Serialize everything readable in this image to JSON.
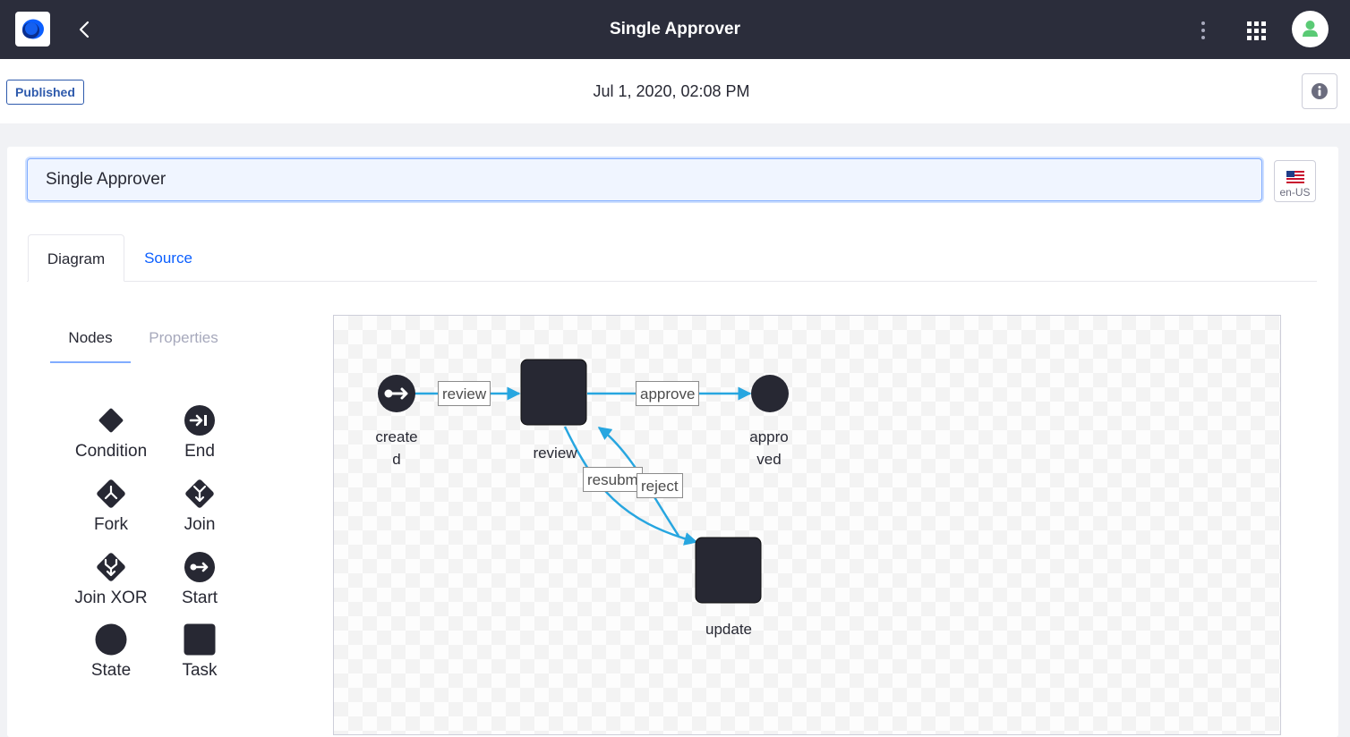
{
  "header": {
    "title": "Single Approver"
  },
  "subheader": {
    "status_badge": "Published",
    "date": "Jul 1, 2020, 02:08 PM"
  },
  "form": {
    "name_value": "Single Approver",
    "language_label": "en-US"
  },
  "tabs": {
    "diagram": "Diagram",
    "source": "Source"
  },
  "panel": {
    "nodes_tab": "Nodes",
    "properties_tab": "Properties",
    "nodes": [
      {
        "label": "Condition",
        "icon": "condition-icon"
      },
      {
        "label": "End",
        "icon": "end-icon"
      },
      {
        "label": "Fork",
        "icon": "fork-icon"
      },
      {
        "label": "Join",
        "icon": "join-icon"
      },
      {
        "label": "Join XOR",
        "icon": "join-xor-icon"
      },
      {
        "label": "Start",
        "icon": "start-icon"
      },
      {
        "label": "State",
        "icon": "state-icon"
      },
      {
        "label": "Task",
        "icon": "task-icon"
      }
    ]
  },
  "diagram": {
    "nodes": {
      "created_line1": "create",
      "created_line2": "d",
      "review": "review",
      "approved_line1": "appro",
      "approved_line2": "ved",
      "update": "update"
    },
    "transitions": {
      "review": "review",
      "approve": "approve",
      "resubmit": "resubm",
      "reject": "reject"
    }
  },
  "colors": {
    "topbar": "#2b2d3b",
    "accent": "#0b5fff",
    "edge": "#27a6e0",
    "node": "#272833"
  }
}
